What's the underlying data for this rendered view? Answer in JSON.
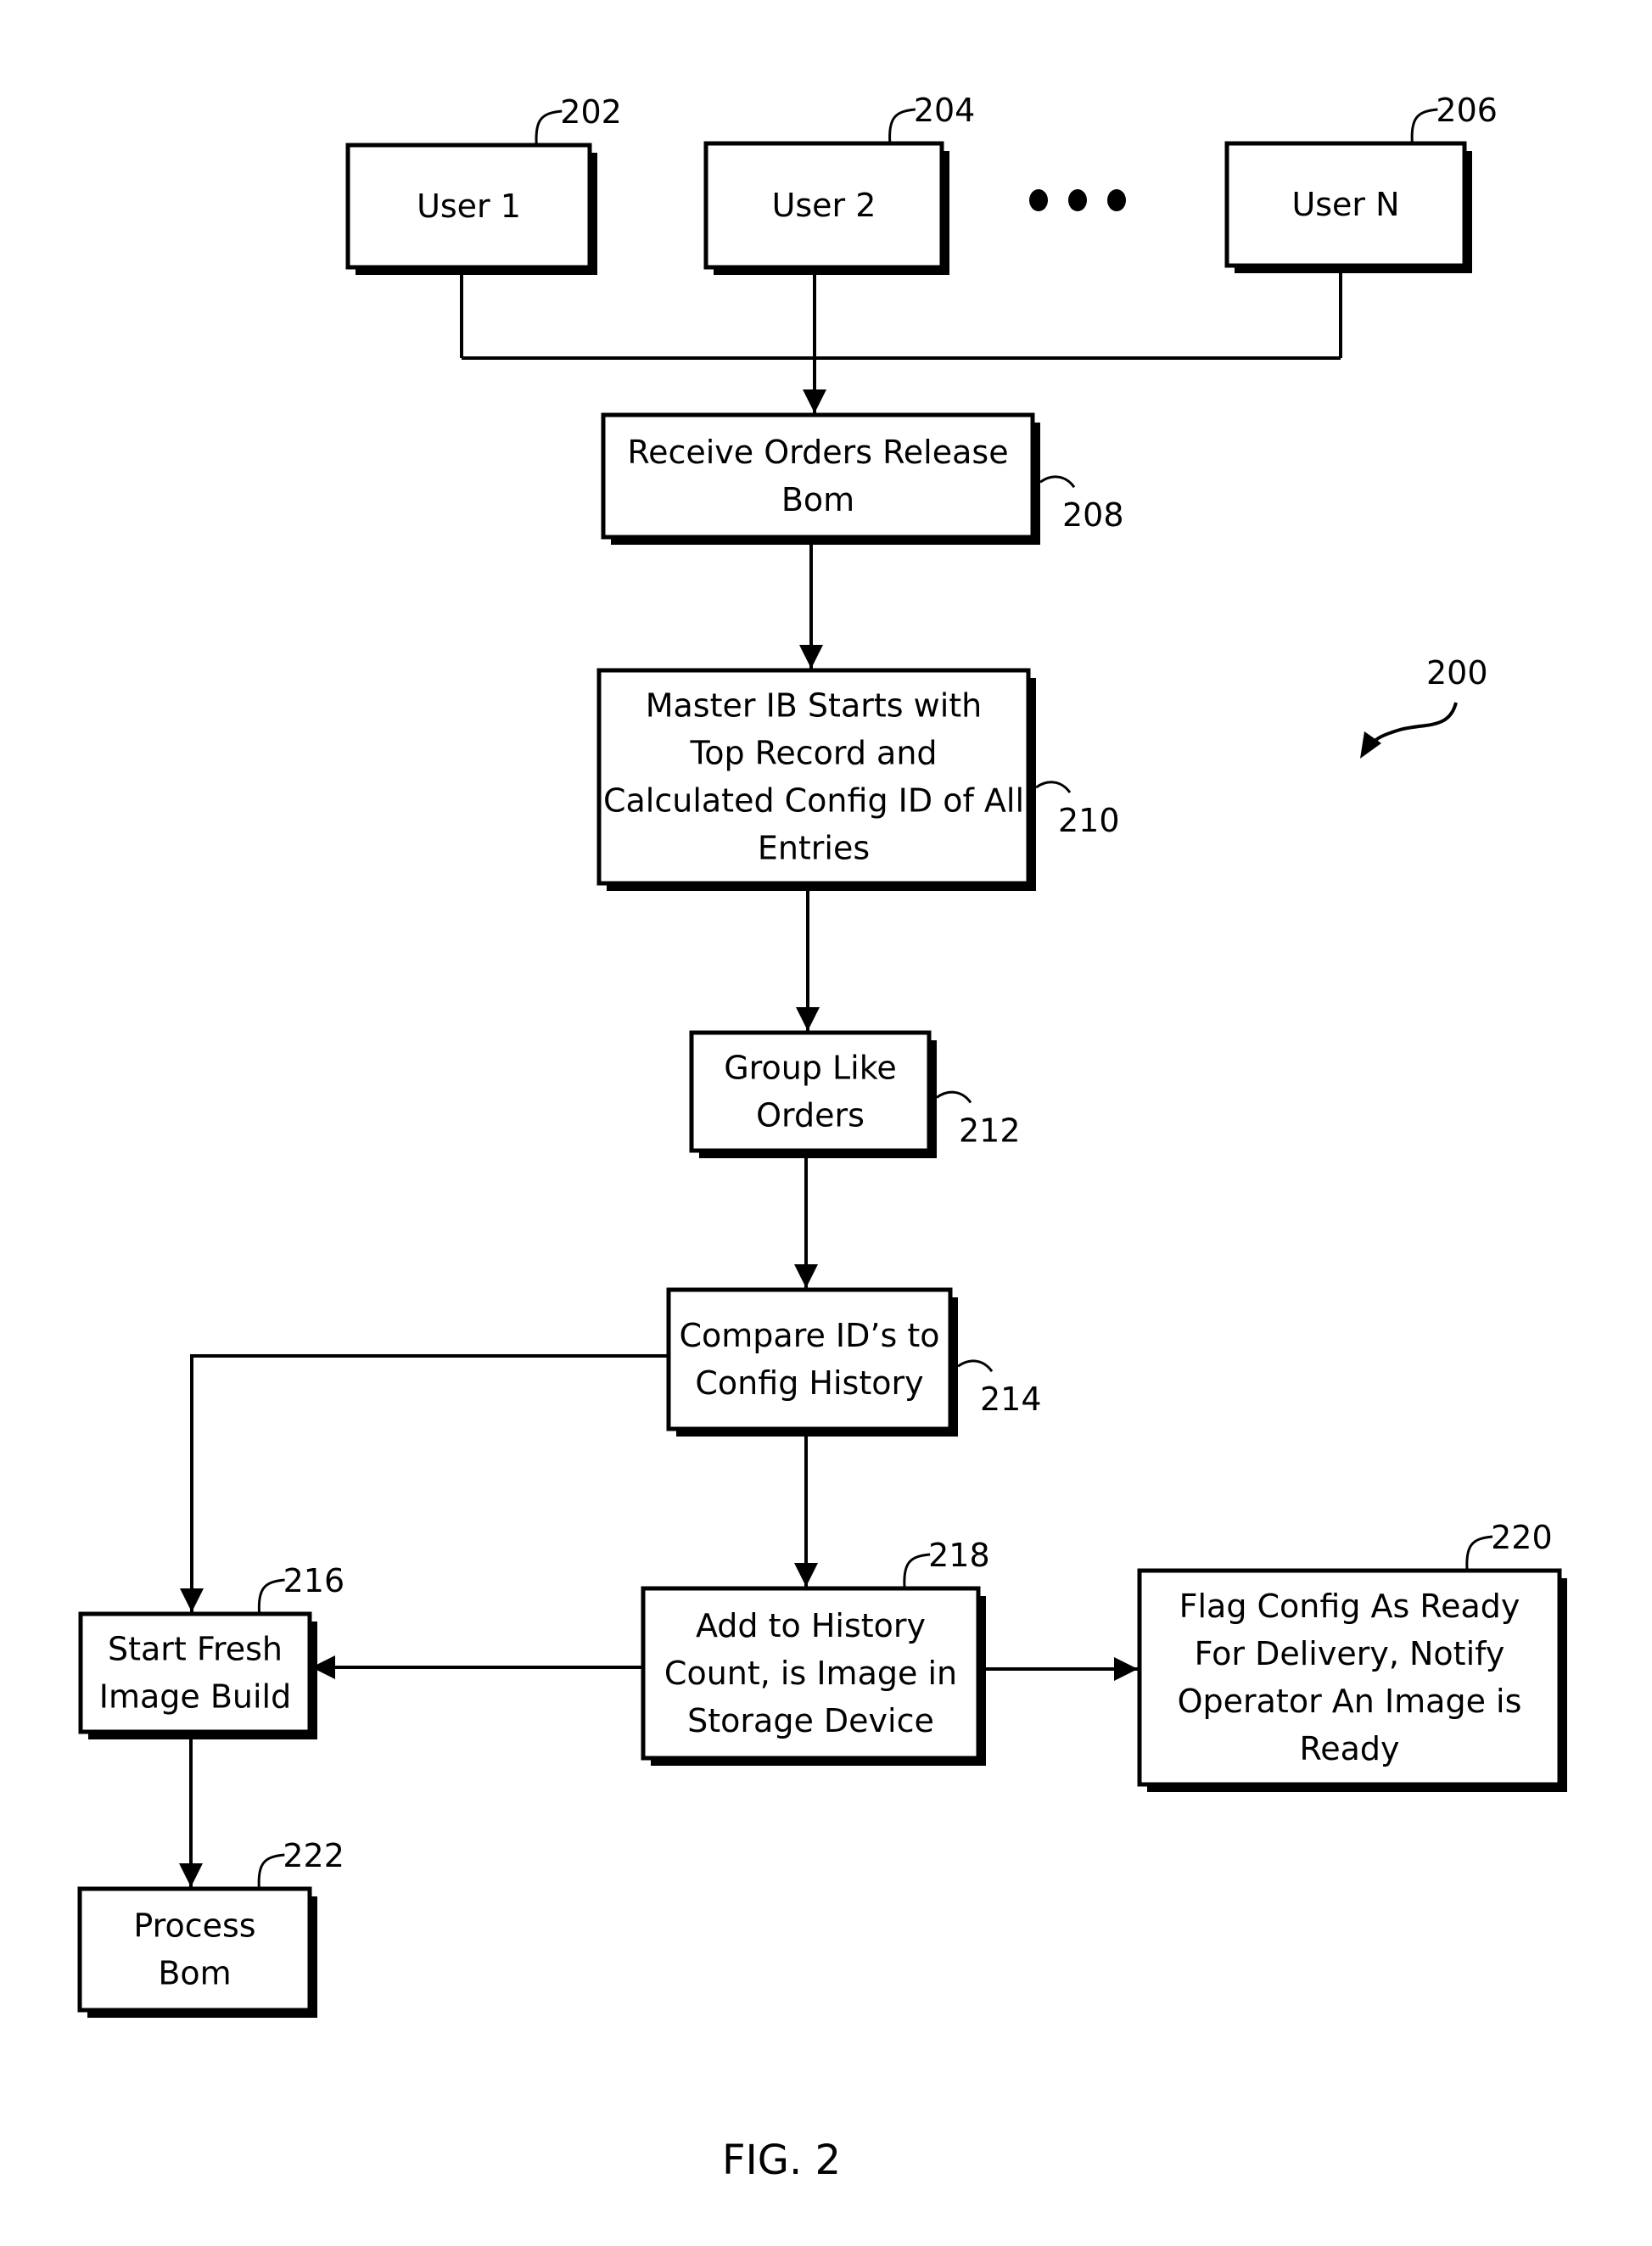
{
  "figure": {
    "label": "FIG. 2",
    "reference": "200"
  },
  "nodes": [
    {
      "id": "202",
      "lines": [
        "User 1"
      ]
    },
    {
      "id": "204",
      "lines": [
        "User 2"
      ]
    },
    {
      "id": "206",
      "lines": [
        "User N"
      ]
    },
    {
      "id": "208",
      "lines": [
        "Receive Orders Release",
        "Bom"
      ]
    },
    {
      "id": "210",
      "lines": [
        "Master IB Starts with",
        "Top Record and",
        "Calculated Config ID of All",
        "Entries"
      ]
    },
    {
      "id": "212",
      "lines": [
        "Group Like",
        "Orders"
      ]
    },
    {
      "id": "214",
      "lines": [
        "Compare ID’s to",
        "Config History"
      ]
    },
    {
      "id": "216",
      "lines": [
        "Start Fresh",
        "Image Build"
      ]
    },
    {
      "id": "218",
      "lines": [
        "Add to History",
        "Count, is Image in",
        "Storage Device"
      ]
    },
    {
      "id": "220",
      "lines": [
        "Flag Config As Ready",
        "For Delivery, Notify",
        "Operator An Image is",
        "Ready"
      ]
    },
    {
      "id": "222",
      "lines": [
        "Process",
        "Bom"
      ]
    }
  ],
  "ellipsis": "• • •",
  "edges": [
    {
      "from": "202",
      "to": "208"
    },
    {
      "from": "204",
      "to": "208"
    },
    {
      "from": "206",
      "to": "208"
    },
    {
      "from": "208",
      "to": "210"
    },
    {
      "from": "210",
      "to": "212"
    },
    {
      "from": "212",
      "to": "214"
    },
    {
      "from": "214",
      "to": "216"
    },
    {
      "from": "214",
      "to": "218"
    },
    {
      "from": "218",
      "to": "216"
    },
    {
      "from": "218",
      "to": "220"
    },
    {
      "from": "216",
      "to": "222"
    }
  ]
}
